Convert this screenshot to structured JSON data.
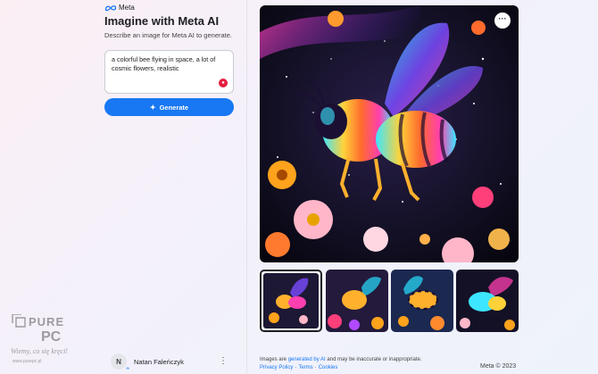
{
  "brand": {
    "name": "Meta",
    "logo_icon": "meta-infinity-icon"
  },
  "header": {
    "title": "Imagine with Meta AI",
    "subtitle": "Describe an image for Meta AI to generate."
  },
  "prompt": {
    "value": "a colorful bee flying in space, a lot of cosmic flowers, realistic"
  },
  "generate_button": {
    "label": "Generate",
    "icon": "sparkle-icon"
  },
  "user": {
    "initial": "N",
    "name": "Natan Faleńczyk",
    "menu_icon": "kebab-icon"
  },
  "watermark": {
    "brand": "PurePC",
    "slogan": "Wiemy, co się kręci"
  },
  "main_image": {
    "alt": "colorful bee in cosmic space with flowers",
    "more_icon": "ellipsis-icon"
  },
  "thumbnails": [
    {
      "label": "variant 1",
      "selected": true
    },
    {
      "label": "variant 2",
      "selected": false
    },
    {
      "label": "variant 3",
      "selected": false
    },
    {
      "label": "variant 4",
      "selected": false
    }
  ],
  "footer": {
    "disclaimer_pre": "Images are ",
    "disclaimer_link": "generated by AI",
    "disclaimer_post": " and may be inaccurate or inappropriate.",
    "privacy": "Privacy Policy",
    "terms": "Terms",
    "cookies": "Cookies",
    "separator": "·",
    "copyright": "Meta © 2023"
  },
  "colors": {
    "accent": "#1877f2",
    "mic": "#e41e3f",
    "text": "#1c1e21"
  }
}
